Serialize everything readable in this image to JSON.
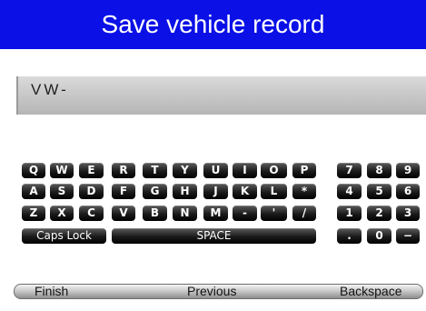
{
  "title": "Save vehicle record",
  "input_value": "VW-",
  "keyboard": {
    "row1": [
      "Q",
      "W",
      "E",
      "R",
      "T",
      "Y",
      "U",
      "I",
      "O",
      "P"
    ],
    "row2": [
      "A",
      "S",
      "D",
      "F",
      "G",
      "H",
      "J",
      "K",
      "L",
      "*"
    ],
    "row3": [
      "Z",
      "X",
      "C",
      "V",
      "B",
      "N",
      "M",
      "-",
      "'",
      "/"
    ],
    "caps_lock": "Caps Lock",
    "space": "SPACE",
    "numpad": [
      [
        "7",
        "8",
        "9"
      ],
      [
        "4",
        "5",
        "6"
      ],
      [
        "1",
        "2",
        "3"
      ],
      [
        ".",
        "0",
        "−"
      ]
    ]
  },
  "bottom_buttons": {
    "finish": "Finish",
    "previous": "Previous",
    "backspace": "Backspace"
  },
  "colors": {
    "title_bar": "#0a10e6",
    "key_face": "#111111"
  }
}
